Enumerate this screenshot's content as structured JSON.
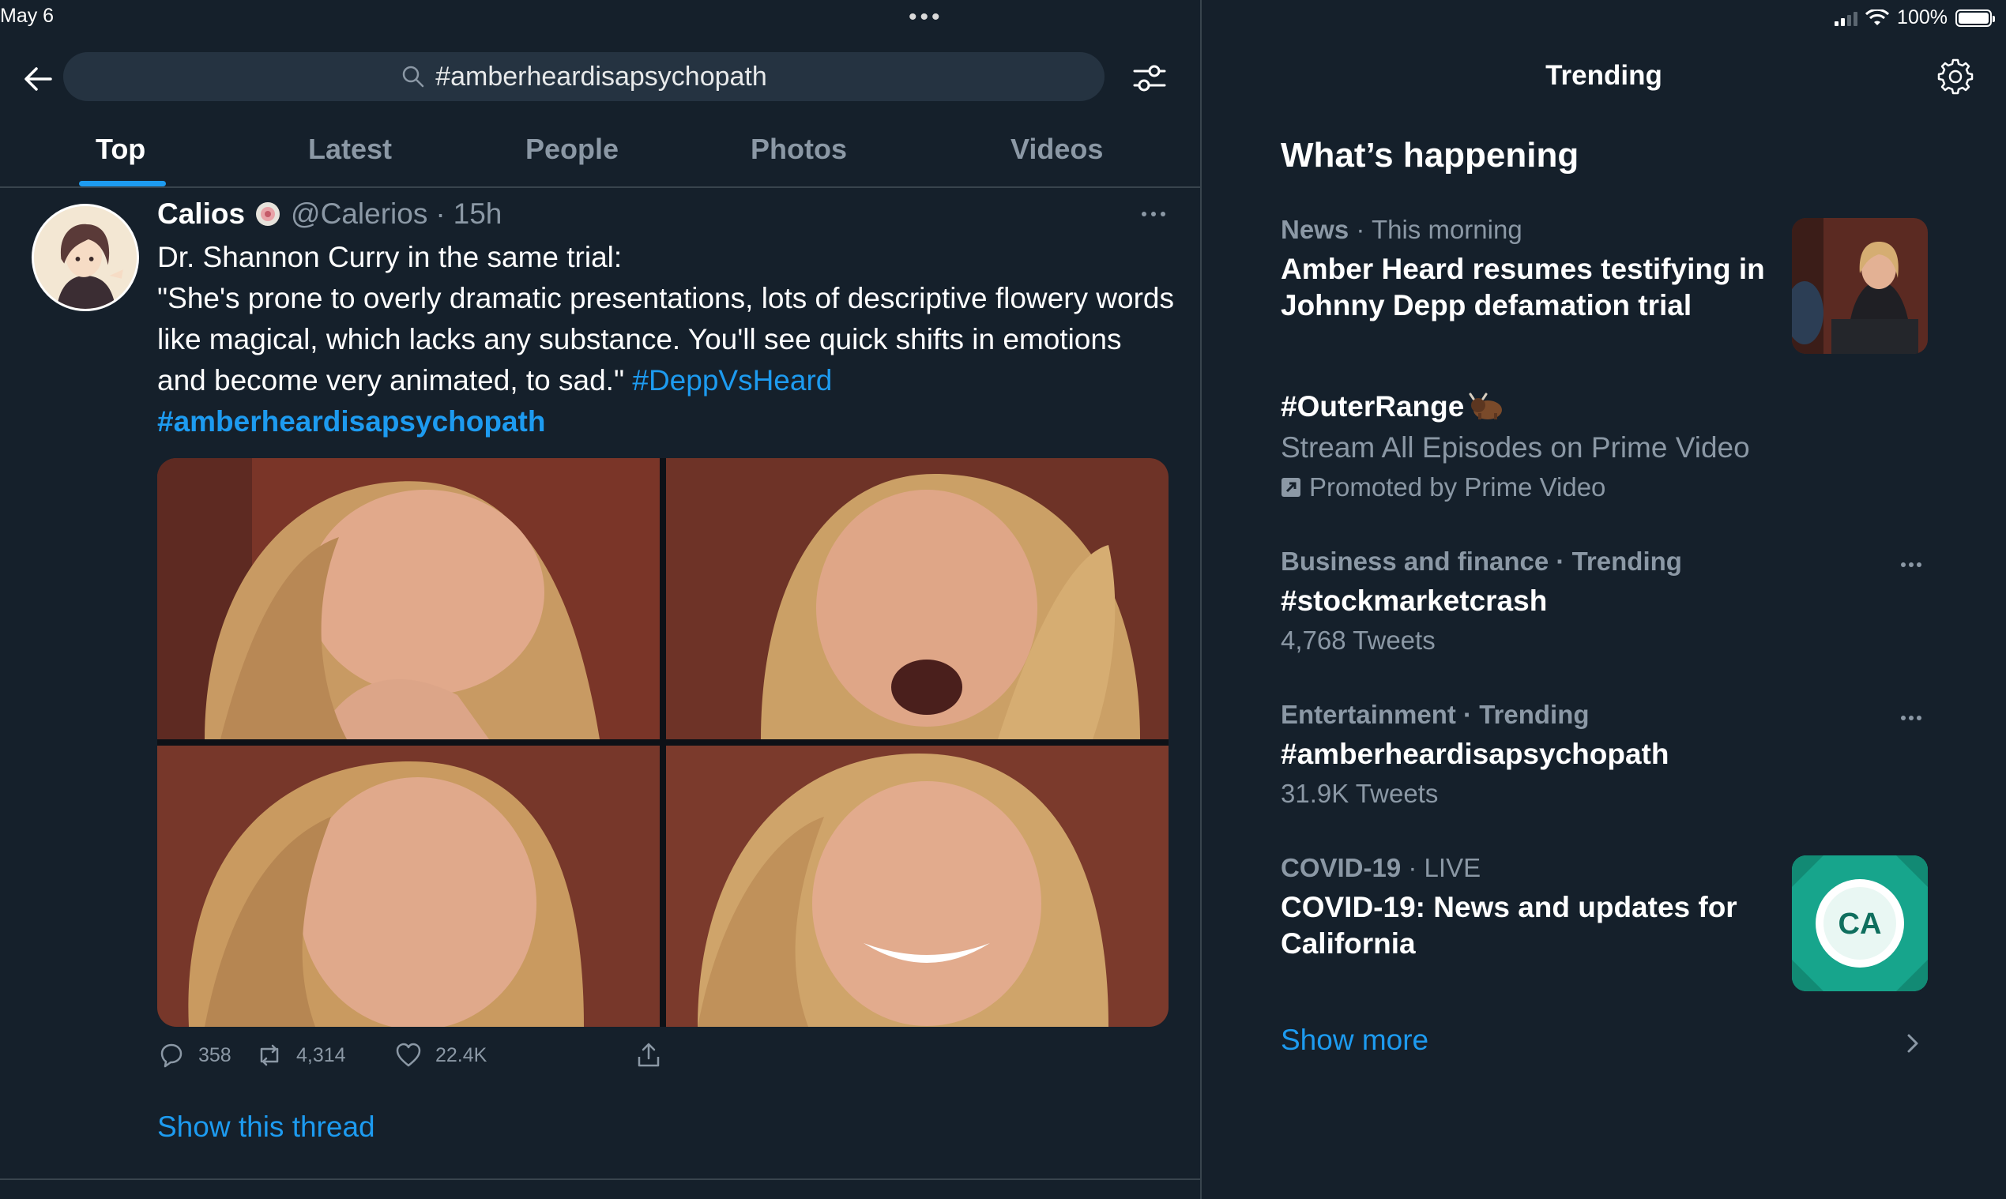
{
  "status_bar": {
    "date": "May 6",
    "battery": "100%"
  },
  "search": {
    "query": "#amberheardisapsychopath"
  },
  "tabs": [
    {
      "label": "Top",
      "active": true
    },
    {
      "label": "Latest",
      "active": false
    },
    {
      "label": "People",
      "active": false
    },
    {
      "label": "Photos",
      "active": false
    },
    {
      "label": "Videos",
      "active": false
    }
  ],
  "tweet": {
    "name": "Calios",
    "handle": "@Calerios",
    "time_sep": "·",
    "time": "15h",
    "text_line1": "Dr. Shannon Curry in the same trial:",
    "text_quote": "\"She's prone to overly dramatic presentations, lots of descriptive flowery words like magical, which lacks any substance. You'll see quick shifts in emotions and become very animated, to sad.\"",
    "hashtag1": "#DeppVsHeard",
    "hashtag2": "#amberheardisapsychopath",
    "replies": "358",
    "retweets": "4,314",
    "likes": "22.4K",
    "show_thread": "Show this thread"
  },
  "right_panel": {
    "header": "Trending",
    "section_title": "What’s happening",
    "trends": [
      {
        "category": "News",
        "sep": " · ",
        "context": "This morning",
        "headline": "Amber Heard resumes testifying in Johnny Depp defamation trial"
      },
      {
        "headline": "#OuterRange",
        "description": "Stream All Episodes on Prime Video",
        "promoted": "Promoted by Prime Video"
      },
      {
        "category": "Business and finance · Trending",
        "headline": "#stockmarketcrash",
        "count": "4,768 Tweets"
      },
      {
        "category": "Entertainment · Trending",
        "headline": "#amberheardisapsychopath",
        "count": "31.9K Tweets"
      },
      {
        "category": "COVID-19",
        "sep": " · ",
        "context": "LIVE",
        "headline": "COVID-19: News and updates for California",
        "thumb_text": "CA"
      }
    ],
    "show_more": "Show more"
  },
  "colors": {
    "background": "#15202b",
    "accent": "#1d9bf0",
    "secondary_text": "#8b98a5",
    "divider": "#38444d"
  }
}
